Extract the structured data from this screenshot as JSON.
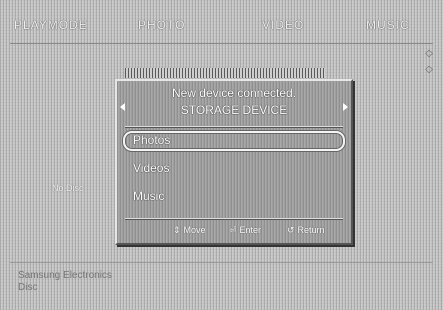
{
  "top_tabs": [
    {
      "label": "PLAYMODE"
    },
    {
      "label": "PHOTO"
    },
    {
      "label": "VIDEO"
    },
    {
      "label": "MUSIC"
    }
  ],
  "left_label": "No Disc",
  "footer_text": [
    "Samsung Electronics",
    "Disc"
  ],
  "dialog": {
    "title": "New device connected.",
    "subtitle": "STORAGE DEVICE",
    "menu": [
      {
        "label": "Photos",
        "selected": true
      },
      {
        "label": "Videos",
        "selected": false
      },
      {
        "label": "Music",
        "selected": false
      }
    ],
    "hints": [
      {
        "icon": "updown-arrows-icon",
        "glyph": "⇕",
        "label": "Move"
      },
      {
        "icon": "enter-icon",
        "glyph": "⏎",
        "label": "Enter"
      },
      {
        "icon": "return-icon",
        "glyph": "↺",
        "label": "Return"
      }
    ]
  }
}
